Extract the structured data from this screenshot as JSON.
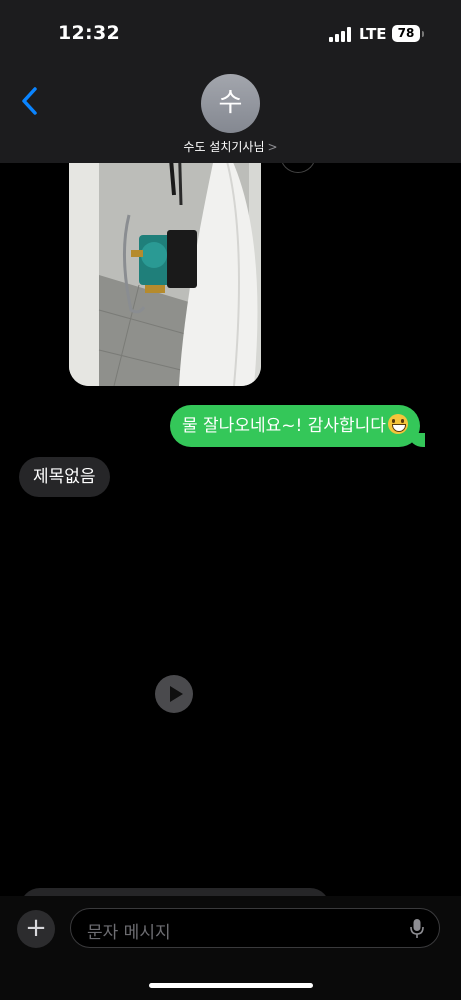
{
  "status_bar": {
    "time": "12:32",
    "network": "LTE",
    "battery": "78"
  },
  "header": {
    "avatar_initial": "수",
    "contact_name": "수도 설치기사님",
    "chevron": ">"
  },
  "messages": {
    "outgoing_text": "물 잘나오네요~! 감사합니다",
    "outgoing_emoji": "grinning-face-emoji",
    "incoming_subject": "제목없음"
  },
  "composer": {
    "add_label": "+",
    "placeholder": "문자 메시지"
  },
  "colors": {
    "outgoing_bubble": "#34c759",
    "incoming_bubble": "#262628",
    "accent": "#0a84ff",
    "header_bg": "#1c1c1e"
  }
}
